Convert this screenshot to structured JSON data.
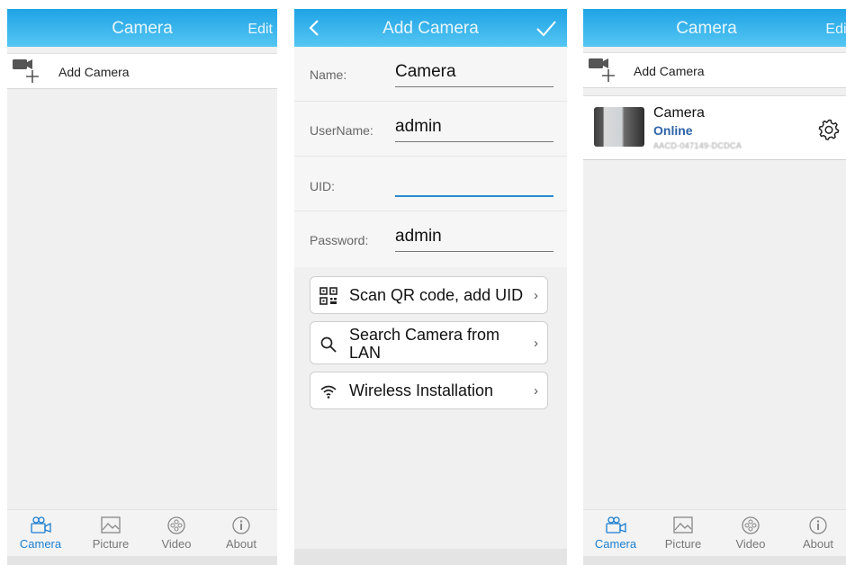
{
  "screen1": {
    "header": {
      "title": "Camera",
      "edit_label": "Edit"
    },
    "add_camera_label": "Add Camera",
    "tabs": [
      {
        "label": "Camera",
        "icon": "camera-icon",
        "active": true
      },
      {
        "label": "Picture",
        "icon": "picture-icon",
        "active": false
      },
      {
        "label": "Video",
        "icon": "video-icon",
        "active": false
      },
      {
        "label": "About",
        "icon": "info-icon",
        "active": false
      }
    ]
  },
  "screen2": {
    "header": {
      "title": "Add Camera"
    },
    "fields": [
      {
        "label": "Name:",
        "value": "Camera"
      },
      {
        "label": "UserName:",
        "value": "admin"
      },
      {
        "label": "UID:",
        "value": ""
      },
      {
        "label": "Password:",
        "value": "admin"
      }
    ],
    "actions": [
      {
        "label": "Scan QR code, add UID",
        "icon": "qr-code-icon"
      },
      {
        "label": "Search Camera from LAN",
        "icon": "search-icon"
      },
      {
        "label": "Wireless Installation",
        "icon": "wifi-icon"
      }
    ]
  },
  "screen3": {
    "header": {
      "title": "Camera",
      "edit_label": "Edit"
    },
    "add_camera_label": "Add Camera",
    "camera": {
      "name": "Camera",
      "status": "Online",
      "uid": "AACD-047149-DCDCA"
    },
    "tabs": [
      {
        "label": "Camera",
        "active": true
      },
      {
        "label": "Picture",
        "active": false
      },
      {
        "label": "Video",
        "active": false
      },
      {
        "label": "About",
        "active": false
      }
    ]
  },
  "colors": {
    "header_top": "#1fa3e6",
    "header_bottom": "#55c6f2",
    "active_tab": "#1b7fd0",
    "online": "#2d63a8"
  }
}
